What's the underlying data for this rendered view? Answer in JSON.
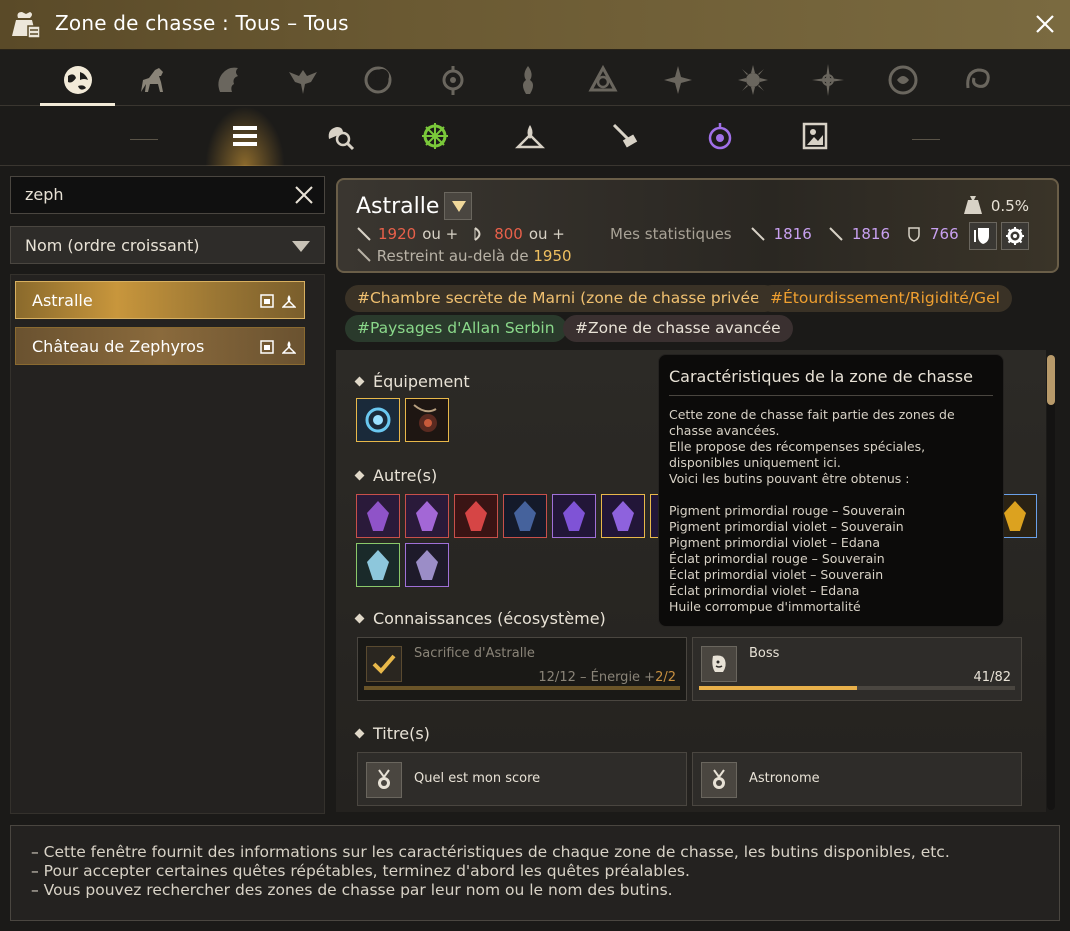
{
  "window": {
    "title": "Zone de chasse : Tous – Tous",
    "close_icon": "close-icon"
  },
  "category_tabs": [
    {
      "icon": "globe-icon",
      "active": true
    },
    {
      "icon": "horse-icon",
      "active": false
    },
    {
      "icon": "lion-icon",
      "active": false
    },
    {
      "icon": "winged-crest-icon",
      "active": false
    },
    {
      "icon": "crescent-icon",
      "active": false
    },
    {
      "icon": "amulet-icon",
      "active": false
    },
    {
      "icon": "flame-totem-icon",
      "active": false
    },
    {
      "icon": "triquetra-icon",
      "active": false
    },
    {
      "icon": "compass-star-icon",
      "active": false
    },
    {
      "icon": "sun-star-icon",
      "active": false
    },
    {
      "icon": "radiant-star-icon",
      "active": false
    },
    {
      "icon": "circle-sigil-icon",
      "active": false
    },
    {
      "icon": "swirl-icon",
      "active": false
    }
  ],
  "sub_tabs": [
    {
      "icon": "list-icon",
      "active": true
    },
    {
      "icon": "search-loot-icon",
      "active": false
    },
    {
      "icon": "green-gear-icon",
      "active": false
    },
    {
      "icon": "camp-icon",
      "active": false
    },
    {
      "icon": "scroll-sword-icon",
      "active": false
    },
    {
      "icon": "purple-lantern-icon",
      "active": false
    },
    {
      "icon": "portrait-icon",
      "active": false
    }
  ],
  "search": {
    "value": "zeph",
    "placeholder": ""
  },
  "sort": {
    "selected": "Nom (ordre croissant)"
  },
  "zone_list": [
    {
      "label": "Astralle",
      "selected": true
    },
    {
      "label": "Château de Zephyros",
      "selected": false
    }
  ],
  "zone": {
    "name": "Astralle",
    "ap_required": "1920",
    "ou1": "ou +",
    "dp_required": "800",
    "ou2": "ou +",
    "restricted_label": "Restreint au-delà de",
    "restricted_value": "1950",
    "my_stats_label": "Mes statistiques",
    "stat_ap": "1816",
    "stat_aap": "1816",
    "stat_dp": "766",
    "drop_rate": "0.5%"
  },
  "tags": [
    {
      "label": "#Chambre secrète de Marni (zone de chasse privée)",
      "style": "gold"
    },
    {
      "label": "#Étourdissement/Rigidité/Gel",
      "style": "orange"
    },
    {
      "label": "#Paysages d'Allan Serbin",
      "style": "green"
    },
    {
      "label": "#Zone de chasse avancée",
      "style": "grey"
    }
  ],
  "sections": {
    "equipment": "Équipement",
    "other": "Autre(s)",
    "knowledge": "Connaissances (écosystème)",
    "titles": "Titre(s)"
  },
  "equipment_items": [
    {
      "icon": "blue-gem-necklace-icon",
      "rarity": "gold"
    },
    {
      "icon": "dark-amulet-icon",
      "rarity": "gold"
    }
  ],
  "other_items": [
    {
      "icon": "purple-pouch-icon",
      "rarity": "red"
    },
    {
      "icon": "purple-orb-pouch-icon",
      "rarity": "red"
    },
    {
      "icon": "red-pouch-icon",
      "rarity": "red"
    },
    {
      "icon": "dark-crystal-icon",
      "rarity": "red"
    },
    {
      "icon": "violet-gem-icon",
      "rarity": "purple"
    },
    {
      "icon": "violet-shard-icon",
      "rarity": "gold"
    },
    {
      "icon": "violet-shard2-icon",
      "rarity": "gold"
    },
    {
      "icon": "violet-shard3-icon",
      "rarity": "purple"
    },
    {
      "icon": "red-shard-icon",
      "rarity": "red"
    },
    {
      "icon": "eye-orb-icon",
      "rarity": "purple"
    },
    {
      "icon": "purple-shard-icon",
      "rarity": "purple"
    },
    {
      "icon": "book-icon",
      "rarity": "red"
    },
    {
      "icon": "red-potion-icon",
      "rarity": "red"
    },
    {
      "icon": "golden-egg-icon",
      "rarity": "blue"
    },
    {
      "icon": "elixir-vial-icon",
      "rarity": "green"
    },
    {
      "icon": "crystal-blade-icon",
      "rarity": "purple"
    }
  ],
  "knowledge": [
    {
      "name": "Sacrifice d'Astralle",
      "progress": "12/12 – Énergie +",
      "bonus": "2/2",
      "fill": 1.0,
      "done": true,
      "icon": "checkmark-icon"
    },
    {
      "name": "Boss",
      "progress": "41/82",
      "bonus": "",
      "fill": 0.5,
      "done": false,
      "icon": "scroll-face-icon"
    }
  ],
  "titles": [
    {
      "name": "Quel est mon score",
      "icon": "medal-icon"
    },
    {
      "name": "Astronome",
      "icon": "medal-icon"
    }
  ],
  "tooltip": {
    "title": "Caractéristiques de la zone de chasse",
    "lines": [
      "Cette zone de chasse fait partie des zones de chasse avancées.",
      "Elle propose des récompenses spéciales, disponibles uniquement ici.",
      "Voici les butins pouvant être obtenus :",
      "",
      "Pigment primordial rouge – Souverain",
      "Pigment primordial violet – Souverain",
      "Pigment primordial violet – Edana",
      "Éclat primordial rouge – Souverain",
      "Éclat primordial violet – Souverain",
      "Éclat primordial violet – Edana",
      "Huile corrompue d'immortalité"
    ]
  },
  "footer": [
    "– Cette fenêtre fournit des informations sur les caractéristiques de chaque zone de chasse, les butins disponibles, etc.",
    "– Pour accepter certaines quêtes répétables, terminez d'abord les quêtes préalables.",
    "– Vous pouvez rechercher des zones de chasse par leur nom ou le nom des butins."
  ],
  "colors": {
    "accent": "#e8b04a",
    "red": "#e8604a",
    "purple": "#c8a0f0",
    "gold": "#f0c060"
  }
}
